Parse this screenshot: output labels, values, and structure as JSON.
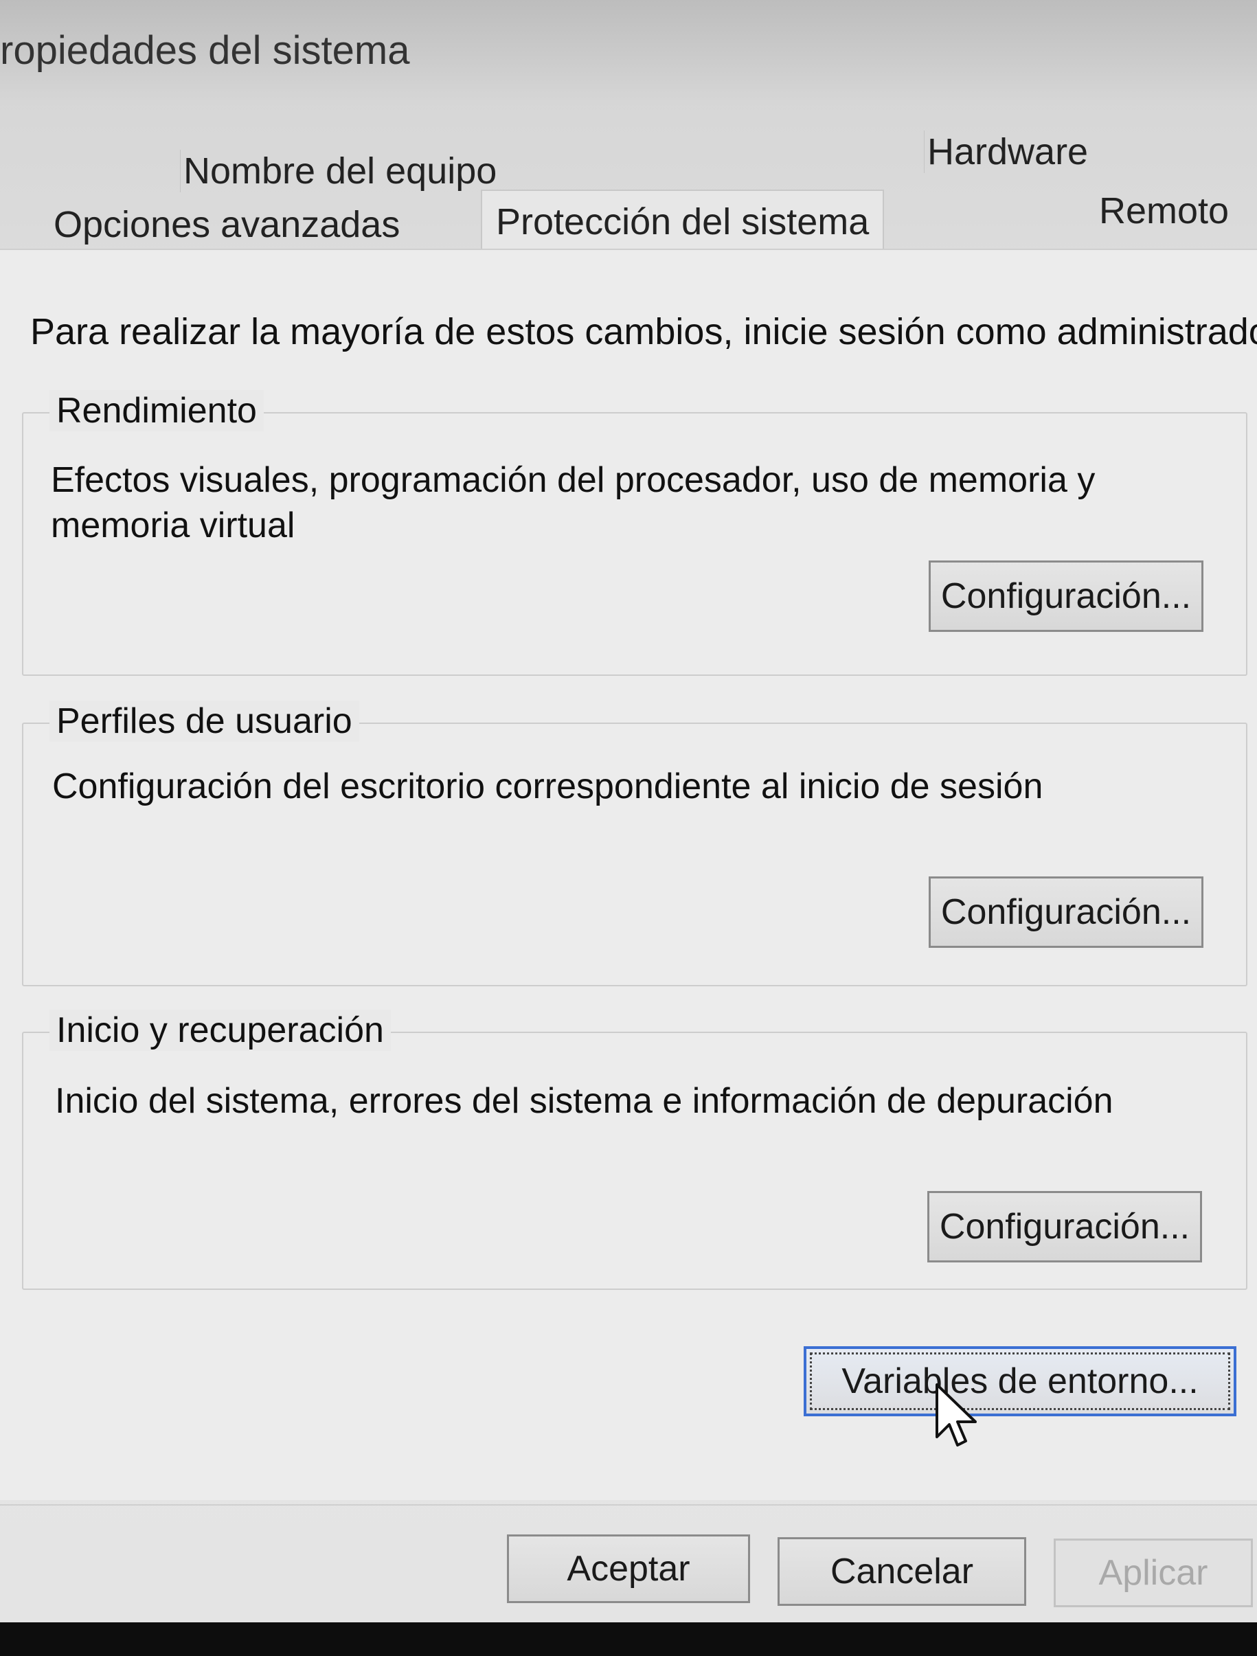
{
  "window": {
    "title": "ropiedades del sistema"
  },
  "tabs": {
    "row1": [
      {
        "label": "Nombre del equipo"
      },
      {
        "label": "Hardware"
      }
    ],
    "row2": [
      {
        "label": "Opciones avanzadas",
        "active": true
      },
      {
        "label": "Protección del sistema"
      },
      {
        "label": "Remoto"
      }
    ]
  },
  "admin_note": "Para realizar la mayoría de estos cambios, inicie sesión como administrador.",
  "groups": {
    "performance": {
      "label": "Rendimiento",
      "description_line1": "Efectos visuales, programación del procesador, uso de memoria y",
      "description_line2": "memoria virtual",
      "button_label": "Configuración..."
    },
    "user_profiles": {
      "label": "Perfiles de usuario",
      "description": "Configuración del escritorio correspondiente al inicio de sesión",
      "button_label": "Configuración..."
    },
    "startup_recovery": {
      "label": "Inicio y recuperación",
      "description": "Inicio del sistema, errores del sistema e información de depuración",
      "button_label": "Configuración..."
    }
  },
  "env_vars_button": {
    "label": "Variables de entorno..."
  },
  "footer": {
    "ok_label": "Aceptar",
    "cancel_label": "Cancelar",
    "apply_label": "Aplicar"
  },
  "colors": {
    "focus_border": "#3b6fd3",
    "disabled_text": "#a9a9a9"
  },
  "icons": {
    "cursor": "mouse-pointer-icon"
  }
}
